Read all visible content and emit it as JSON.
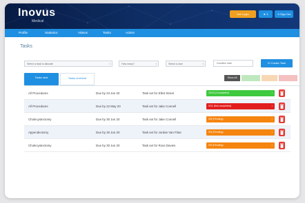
{
  "header": {
    "logo_main": "Inovus",
    "logo_sub": "Medical",
    "buttons": {
      "get_logbook": "Get LogIn",
      "badge": "★ 3",
      "sign_out": "⇥ Sign Out"
    }
  },
  "nav": {
    "items": [
      "Profile",
      "Statistics",
      "Videos",
      "Tasks",
      "Admin"
    ]
  },
  "page": {
    "title": "Tasks"
  },
  "form": {
    "task_select": "Select a task to allocate",
    "how_many_select": "How many?",
    "user_select": "Select a user",
    "deadline_placeholder": "Deadline date",
    "create_button": "☑ Create Task"
  },
  "tabs": {
    "sent": "Tasks sent",
    "received": "Tasks received"
  },
  "filters": {
    "show_all": "Show All"
  },
  "colors": {
    "green": "#3ec93e",
    "red": "#e21d1d",
    "orange": "#f5850f",
    "filter_green": "#bfe8bf",
    "filter_orange": "#f8d7b5",
    "filter_red": "#f5c0c0",
    "accent": "#1f8fe1"
  },
  "tasks": [
    {
      "procedure": "All Procedures",
      "due": "Due by 23 Jun 20",
      "note": "Task set for Elliot Street",
      "status": "10/10 (Completed)",
      "status_color": "green"
    },
    {
      "procedure": "All Procedures",
      "due": "Due by 22 May 20",
      "note": "Task set for Jake Connell",
      "status": "0/11 (Not completed)",
      "status_color": "red"
    },
    {
      "procedure": "Cholecystectomy",
      "due": "Due by 30 Jun 20",
      "note": "Task set for Jake Connell",
      "status": "0/5 (Pending)",
      "status_color": "orange"
    },
    {
      "procedure": "Appendectomy",
      "due": "Due by 30 Jun 20",
      "note": "Task set for Jordan Van Flute",
      "status": "0/5 (Pending)",
      "status_color": "orange"
    },
    {
      "procedure": "Cholecystectomy",
      "due": "Due by 30 Jun 20",
      "note": "Task set for Ross Davies",
      "status": "0/5 (Pending)",
      "status_color": "orange"
    }
  ]
}
